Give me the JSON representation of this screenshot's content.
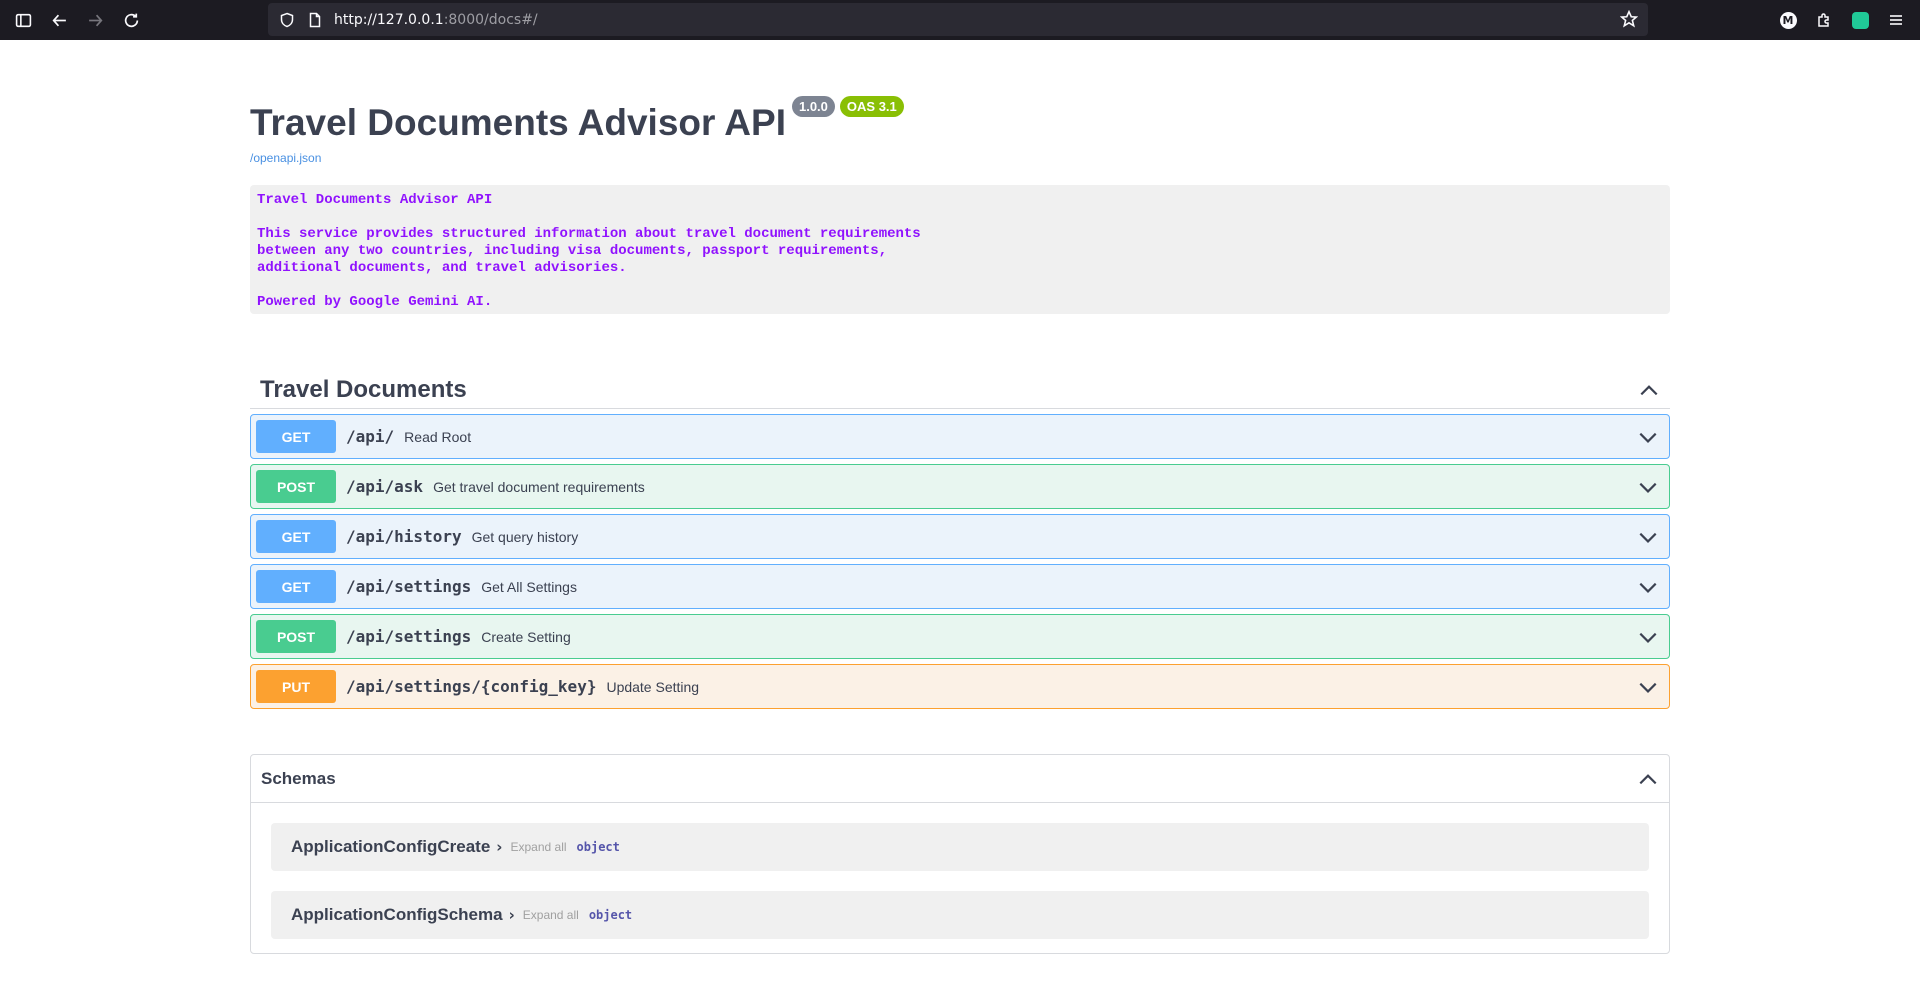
{
  "browser": {
    "url_host": "http://127.0.0.1",
    "url_rest": ":8000/docs#/",
    "profile_initial": "M"
  },
  "info": {
    "title": "Travel Documents Advisor API",
    "version": "1.0.0",
    "oas": "OAS 3.1",
    "spec_link": "/openapi.json",
    "description": "Travel Documents Advisor API\n\nThis service provides structured information about travel document requirements\nbetween any two countries, including visa documents, passport requirements,\nadditional documents, and travel advisories.\n\nPowered by Google Gemini AI."
  },
  "tag": {
    "name": "Travel Documents",
    "operations": [
      {
        "method": "GET",
        "path": "/api/",
        "summary": "Read Root"
      },
      {
        "method": "POST",
        "path": "/api/ask",
        "summary": "Get travel document requirements"
      },
      {
        "method": "GET",
        "path": "/api/history",
        "summary": "Get query history"
      },
      {
        "method": "GET",
        "path": "/api/settings",
        "summary": "Get All Settings"
      },
      {
        "method": "POST",
        "path": "/api/settings",
        "summary": "Create Setting"
      },
      {
        "method": "PUT",
        "path": "/api/settings/{config_key}",
        "summary": "Update Setting"
      }
    ]
  },
  "schemas": {
    "title": "Schemas",
    "models": [
      {
        "name": "ApplicationConfigCreate",
        "expand": "Expand all",
        "type": "object"
      },
      {
        "name": "ApplicationConfigSchema",
        "expand": "Expand all",
        "type": "object"
      }
    ]
  },
  "colors": {
    "get": "#61affe",
    "post": "#49cc90",
    "put": "#fca130",
    "description_text": "#9012fe",
    "link": "#4990e2"
  }
}
